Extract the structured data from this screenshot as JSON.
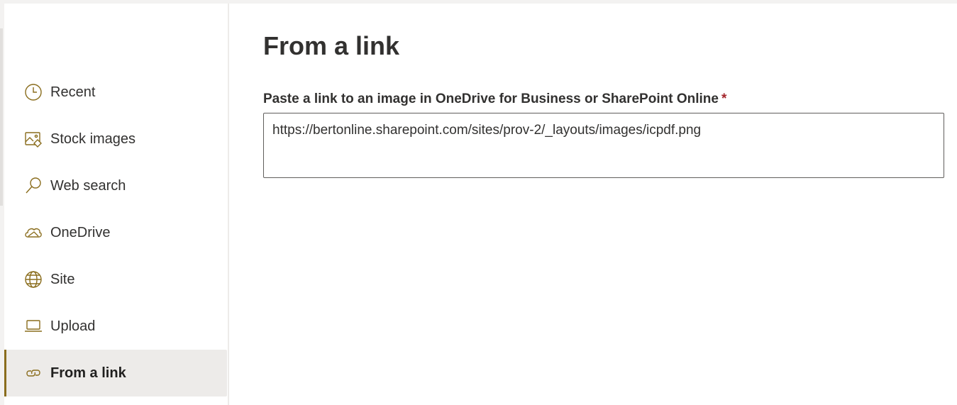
{
  "sidebar": {
    "items": [
      {
        "label": "Recent",
        "icon": "clock-icon",
        "selected": false
      },
      {
        "label": "Stock images",
        "icon": "image-icon",
        "selected": false
      },
      {
        "label": "Web search",
        "icon": "search-icon",
        "selected": false
      },
      {
        "label": "OneDrive",
        "icon": "cloud-icon",
        "selected": false
      },
      {
        "label": "Site",
        "icon": "globe-icon",
        "selected": false
      },
      {
        "label": "Upload",
        "icon": "laptop-icon",
        "selected": false
      },
      {
        "label": "From a link",
        "icon": "link-icon",
        "selected": true
      }
    ]
  },
  "main": {
    "title": "From a link",
    "field_label": "Paste a link to an image in OneDrive for Business or SharePoint Online",
    "required_marker": "*",
    "link_value": "https://bertonline.sharepoint.com/sites/prov-2/_layouts/images/icpdf.png"
  },
  "colors": {
    "accent": "#8a6d1d",
    "required": "#a4262c",
    "selected_bg": "#edebe9",
    "text": "#323130"
  }
}
